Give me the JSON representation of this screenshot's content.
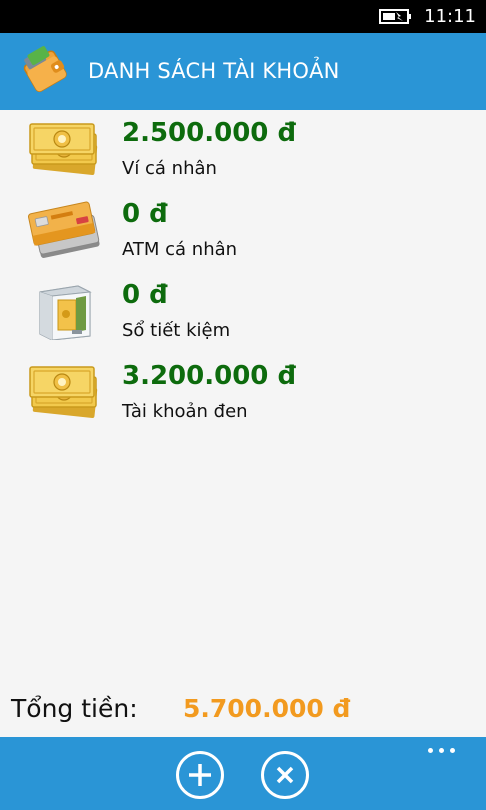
{
  "status_bar": {
    "time": "11:11"
  },
  "header": {
    "title": "DANH SÁCH TÀI KHOẢN"
  },
  "accounts": [
    {
      "amount": "2.500.000 đ",
      "name": "Ví cá nhân",
      "icon": "money-bills-icon"
    },
    {
      "amount": "0 đ",
      "name": "ATM cá nhân",
      "icon": "credit-card-icon"
    },
    {
      "amount": "0 đ",
      "name": "Sổ tiết kiệm",
      "icon": "safe-icon"
    },
    {
      "amount": "3.200.000 đ",
      "name": "Tài khoản đen",
      "icon": "money-bills-icon"
    }
  ],
  "total": {
    "label": "Tổng tiền:",
    "value": "5.700.000 đ"
  },
  "appbar": {
    "add_icon": "add-icon",
    "delete_icon": "delete-icon",
    "more_icon": "more-icon"
  },
  "colors": {
    "accent": "#2a95d6",
    "amount": "#0d6b0d",
    "total": "#f29a1f",
    "background": "#f5f5f5"
  }
}
